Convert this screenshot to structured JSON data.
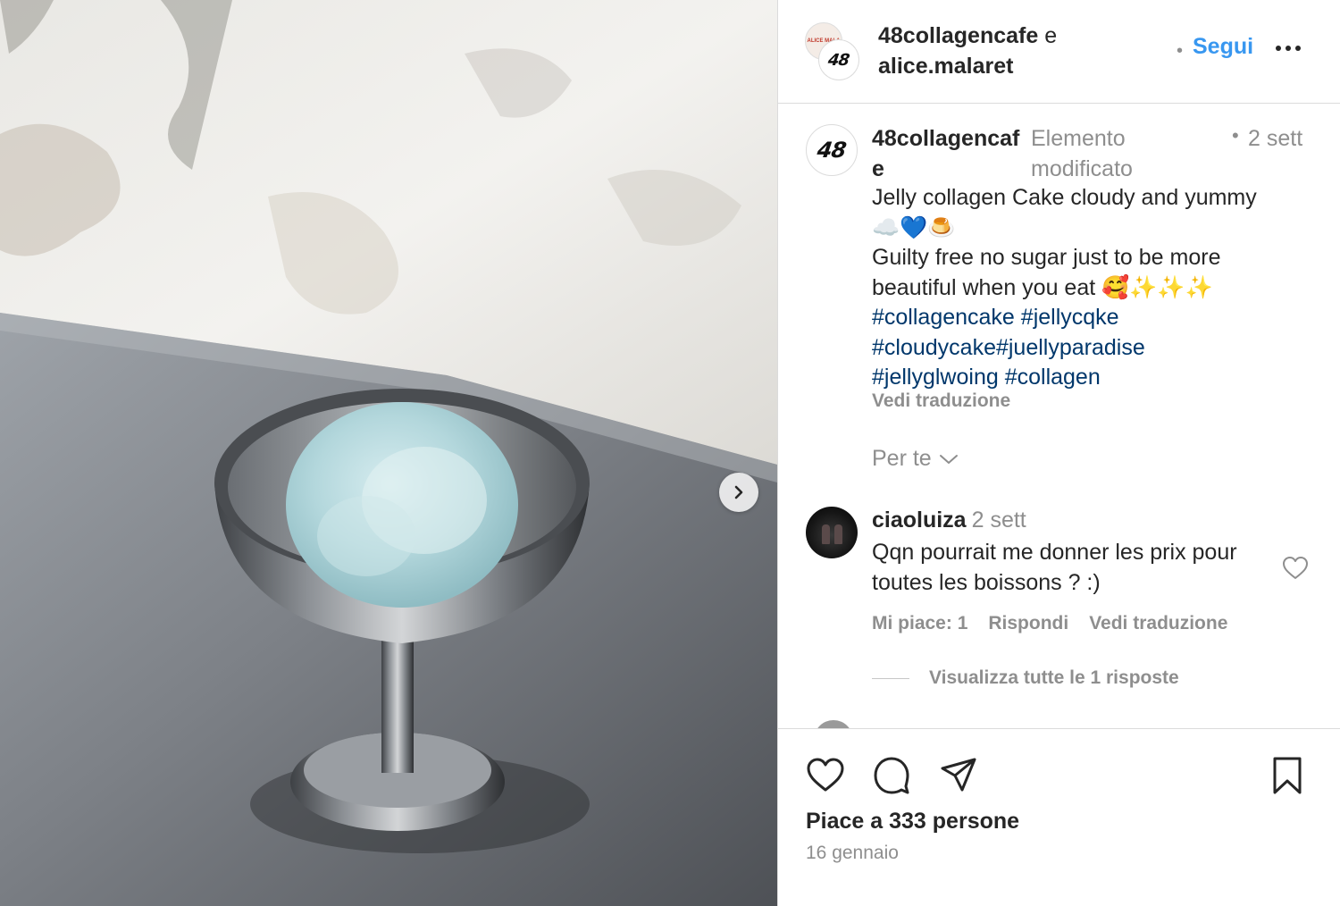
{
  "header": {
    "account_1": "48collagencafe",
    "and": "e",
    "account_2": "alice.malaret",
    "follow_label": "Segui",
    "more_icon": "more-horizontal-icon",
    "small_avatar_text": "ALICE MALA",
    "logo_text": "48"
  },
  "post": {
    "username": "48collagencafe",
    "edited": "Elemento modificato",
    "time": "2 sett",
    "caption_line1": "Jelly collagen Cake cloudy and yummy",
    "caption_emoji1": "☁️💙🍮",
    "caption_line2": "Guilty free no sugar just to be more beautiful when you eat",
    "caption_emoji2": "🥰✨✨✨",
    "hashtags": [
      "#collagencake",
      "#jellycqke",
      "#cloudycake#juellyparadise",
      "#jellyglwoing",
      "#collagen"
    ],
    "see_translation": "Vedi traduzione"
  },
  "filter": {
    "label": "Per te",
    "icon": "chevron-down-icon"
  },
  "comment": {
    "username": "ciaoluiza",
    "time": "2 sett",
    "text": "Qqn pourrait me donner les prix pour toutes les boissons ? :)",
    "likes": "Mi piace: 1",
    "reply": "Rispondi",
    "see_translation": "Vedi traduzione",
    "view_replies": "Visualizza tutte le 1 risposte"
  },
  "footer": {
    "likes": "Piace a 333 persone",
    "date": "16 gennaio"
  },
  "colors": {
    "link_blue": "#3897f0",
    "hashtag_blue": "#00376b",
    "muted_gray": "#8e8e8e",
    "text": "#262626"
  }
}
